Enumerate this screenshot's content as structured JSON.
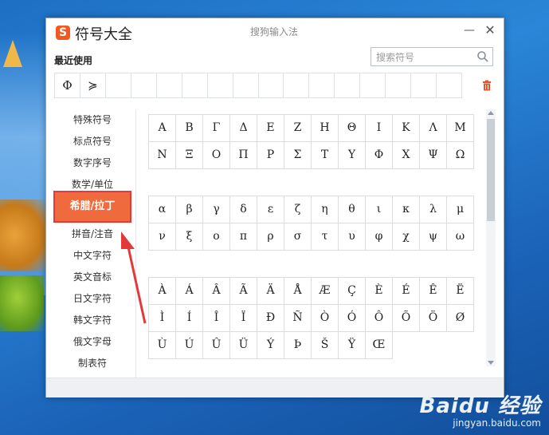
{
  "window": {
    "title": "符号大全",
    "center_title": "搜狗输入法",
    "min_label": "—",
    "close_label": "✕",
    "logo_letter": "S",
    "brand_color": "#f05a22"
  },
  "recent": {
    "label": "最近使用",
    "symbols": [
      "Φ",
      "≽",
      "",
      "",
      "",
      "",
      "",
      "",
      "",
      "",
      "",
      "",
      "",
      "",
      "",
      ""
    ]
  },
  "search": {
    "placeholder": "搜索符号"
  },
  "sidebar": {
    "items": [
      {
        "label": "特殊符号"
      },
      {
        "label": "标点符号"
      },
      {
        "label": "数字序号"
      },
      {
        "label": "数学/单位"
      },
      {
        "label": "希腊/拉丁",
        "active": true
      },
      {
        "label": "拼音/注音"
      },
      {
        "label": "中文字符"
      },
      {
        "label": "英文音标"
      },
      {
        "label": "日文字符"
      },
      {
        "label": "韩文字符"
      },
      {
        "label": "俄文字母"
      },
      {
        "label": "制表符"
      }
    ],
    "active_color": "#ef6a3d"
  },
  "grids": {
    "greek_upper": [
      "Α",
      "Β",
      "Γ",
      "Δ",
      "Ε",
      "Ζ",
      "Η",
      "Θ",
      "Ι",
      "Κ",
      "Λ",
      "Μ",
      "Ν",
      "Ξ",
      "Ο",
      "Π",
      "Ρ",
      "Σ",
      "Τ",
      "Υ",
      "Φ",
      "Χ",
      "Ψ",
      "Ω"
    ],
    "greek_lower": [
      "α",
      "β",
      "γ",
      "δ",
      "ε",
      "ζ",
      "η",
      "θ",
      "ι",
      "κ",
      "λ",
      "μ",
      "ν",
      "ξ",
      "ο",
      "π",
      "ρ",
      "σ",
      "τ",
      "υ",
      "φ",
      "χ",
      "ψ",
      "ω"
    ],
    "latin": [
      "À",
      "Á",
      "Â",
      "Ã",
      "Ä",
      "Å",
      "Æ",
      "Ç",
      "È",
      "É",
      "Ê",
      "Ë",
      "Ì",
      "Í",
      "Î",
      "Ï",
      "Ð",
      "Ñ",
      "Ò",
      "Ó",
      "Ô",
      "Õ",
      "Ö",
      "Ø",
      "Ù",
      "Ú",
      "Û",
      "Ü",
      "Ý",
      "Þ",
      "Š",
      "Ÿ",
      "Œ"
    ]
  },
  "watermark": {
    "brand": "Baidu 经验",
    "url": "jingyan.baidu.com"
  }
}
